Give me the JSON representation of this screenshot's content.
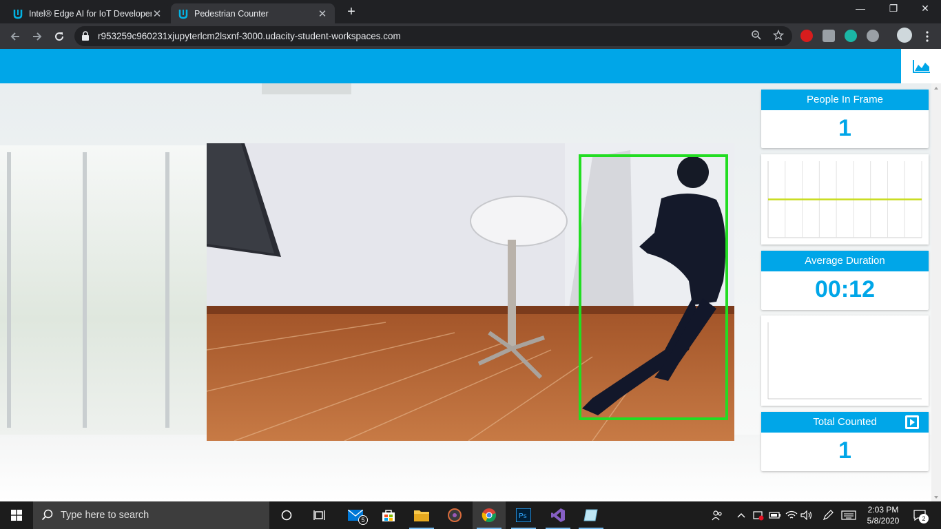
{
  "browser": {
    "tabs": [
      {
        "title": "Intel® Edge AI for IoT Developer",
        "active": false
      },
      {
        "title": "Pedestrian Counter",
        "active": true
      }
    ],
    "new_tab_label": "+",
    "url": "r953259c960231xjupyterlcm2lsxnf-3000.udacity-student-workspaces.com",
    "window_controls": {
      "minimize": "—",
      "restore": "❐",
      "close": "✕"
    }
  },
  "app": {
    "header_color": "#00a6e8",
    "chart_icon": "area-chart-icon"
  },
  "video": {
    "detection_box_color": "#22dd22"
  },
  "stats": {
    "people_in_frame": {
      "label": "People In Frame",
      "value": "1"
    },
    "average_duration": {
      "label": "Average Duration",
      "value": "00:12"
    },
    "total_counted": {
      "label": "Total Counted",
      "value": "1"
    }
  },
  "chart_data": [
    {
      "type": "line",
      "series": [
        {
          "values": [
            1,
            1,
            1,
            1,
            1,
            1,
            1,
            1,
            1,
            1
          ]
        }
      ],
      "line_color": "#c8dc1e",
      "grid": true
    },
    {
      "type": "line",
      "series": [
        {
          "values": []
        }
      ],
      "grid": false
    }
  ],
  "taskbar": {
    "search_placeholder": "Type here to search",
    "mail_badge": "5",
    "time": "2:03 PM",
    "date": "5/8/2020",
    "notification_count": "2"
  }
}
